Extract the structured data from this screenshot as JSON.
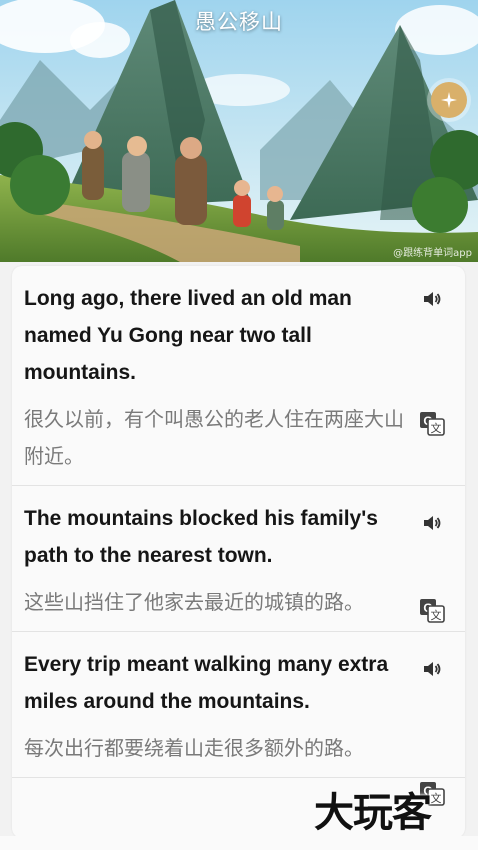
{
  "header": {
    "title": "愚公移山",
    "watermark": "@跟练背单词app",
    "action_icon": "sparkle-icon",
    "colors": {
      "sky": "#bfe3f2",
      "mountain": "#4f7b68",
      "accent_button": "#d9b06a"
    }
  },
  "sentences": [
    {
      "english": "Long ago, there lived an old man named Yu Gong near two tall mountains.",
      "chinese": "很久以前，有个叫愚公的老人住在两座大山附近。",
      "audio_icon": "speaker-icon",
      "translate_icon": "translate-icon"
    },
    {
      "english": "The mountains blocked his family's path to the nearest town.",
      "chinese": "这些山挡住了他家去最近的城镇的路。",
      "audio_icon": "speaker-icon",
      "translate_icon": "translate-icon"
    },
    {
      "english": "Every trip meant walking many extra miles around the mountains.",
      "chinese": "每次出行都要绕着山走很多额外的路。",
      "audio_icon": "speaker-icon",
      "translate_icon": "translate-icon"
    }
  ],
  "overlay_logo": "大玩客"
}
